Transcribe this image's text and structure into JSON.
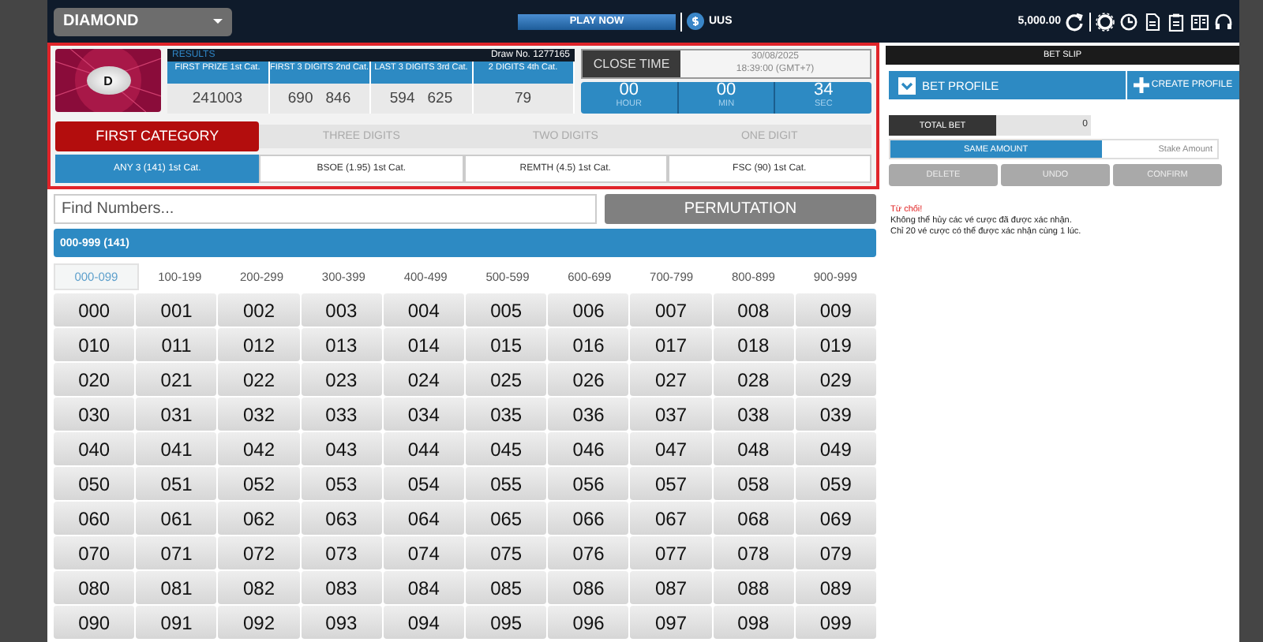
{
  "game_select": {
    "value": "DIAMOND"
  },
  "top_bar": {
    "play_button": "PLAY NOW",
    "currency": "UUS",
    "balance": "5,000.00"
  },
  "logo": {
    "letter": "D"
  },
  "results": {
    "title": "RESULTS",
    "draw_no": "Draw No. 1277165",
    "columns": [
      {
        "label": "FIRST PRIZE 1st Cat.",
        "values": [
          "241003"
        ]
      },
      {
        "label": "FIRST 3 DIGITS 2nd Cat.",
        "values": [
          "690",
          "846"
        ]
      },
      {
        "label": "LAST 3 DIGITS 3rd Cat.",
        "values": [
          "594",
          "625"
        ]
      },
      {
        "label": "2 DIGITS 4th Cat.",
        "values": [
          "79"
        ]
      }
    ]
  },
  "close_time": {
    "label": "CLOSE TIME",
    "date": "30/08/2025",
    "time": "18:39:00 (GMT+7)",
    "countdown": [
      {
        "value": "00",
        "unit": "HOUR"
      },
      {
        "value": "00",
        "unit": "MIN"
      },
      {
        "value": "34",
        "unit": "SEC"
      }
    ]
  },
  "category_tabs": [
    {
      "label": "FIRST CATEGORY",
      "selected": true
    },
    {
      "label": "THREE DIGITS",
      "selected": false
    },
    {
      "label": "TWO DIGITS",
      "selected": false
    },
    {
      "label": "ONE DIGIT",
      "selected": false
    }
  ],
  "bet_types": [
    {
      "label": "ANY 3 (141) 1st Cat.",
      "selected": true
    },
    {
      "label": "BSOE (1.95) 1st Cat.",
      "selected": false
    },
    {
      "label": "REMTH (4.5) 1st Cat.",
      "selected": false
    },
    {
      "label": "FSC (90) 1st Cat.",
      "selected": false
    }
  ],
  "search": {
    "placeholder": "Find Numbers..."
  },
  "permutation_button": "PERMUTATION",
  "range_header": "000-999 (141)",
  "range_tabs": [
    {
      "label": "000-099",
      "selected": true
    },
    {
      "label": "100-199",
      "selected": false
    },
    {
      "label": "200-299",
      "selected": false
    },
    {
      "label": "300-399",
      "selected": false
    },
    {
      "label": "400-499",
      "selected": false
    },
    {
      "label": "500-599",
      "selected": false
    },
    {
      "label": "600-699",
      "selected": false
    },
    {
      "label": "700-799",
      "selected": false
    },
    {
      "label": "800-899",
      "selected": false
    },
    {
      "label": "900-999",
      "selected": false
    }
  ],
  "numbers": [
    [
      "000",
      "001",
      "002",
      "003",
      "004",
      "005",
      "006",
      "007",
      "008",
      "009"
    ],
    [
      "010",
      "011",
      "012",
      "013",
      "014",
      "015",
      "016",
      "017",
      "018",
      "019"
    ],
    [
      "020",
      "021",
      "022",
      "023",
      "024",
      "025",
      "026",
      "027",
      "028",
      "029"
    ],
    [
      "030",
      "031",
      "032",
      "033",
      "034",
      "035",
      "036",
      "037",
      "038",
      "039"
    ],
    [
      "040",
      "041",
      "042",
      "043",
      "044",
      "045",
      "046",
      "047",
      "048",
      "049"
    ],
    [
      "050",
      "051",
      "052",
      "053",
      "054",
      "055",
      "056",
      "057",
      "058",
      "059"
    ],
    [
      "060",
      "061",
      "062",
      "063",
      "064",
      "065",
      "066",
      "067",
      "068",
      "069"
    ],
    [
      "070",
      "071",
      "072",
      "073",
      "074",
      "075",
      "076",
      "077",
      "078",
      "079"
    ],
    [
      "080",
      "081",
      "082",
      "083",
      "084",
      "085",
      "086",
      "087",
      "088",
      "089"
    ],
    [
      "090",
      "091",
      "092",
      "093",
      "094",
      "095",
      "096",
      "097",
      "098",
      "099"
    ]
  ],
  "bet_slip": {
    "title": "BET SLIP",
    "profile_button": "BET PROFILE",
    "create_button": "CREATE PROFILE",
    "total_bet_label": "TOTAL BET",
    "total_bet": "0",
    "amount_modes": [
      {
        "label": "SAME AMOUNT",
        "selected": true
      },
      {
        "label": "Stake Amount",
        "selected": false
      }
    ],
    "actions": [
      {
        "label": "DELETE",
        "disabled": true
      },
      {
        "label": "UNDO",
        "disabled": true
      },
      {
        "label": "CONFIRM",
        "disabled": true
      }
    ],
    "message_title": "Từ chối!",
    "message_lines": [
      "Không thể hủy các vé cược đã được xác nhận.",
      "Chỉ 20 vé cược có thể được xác nhận cùng 1 lúc."
    ]
  }
}
